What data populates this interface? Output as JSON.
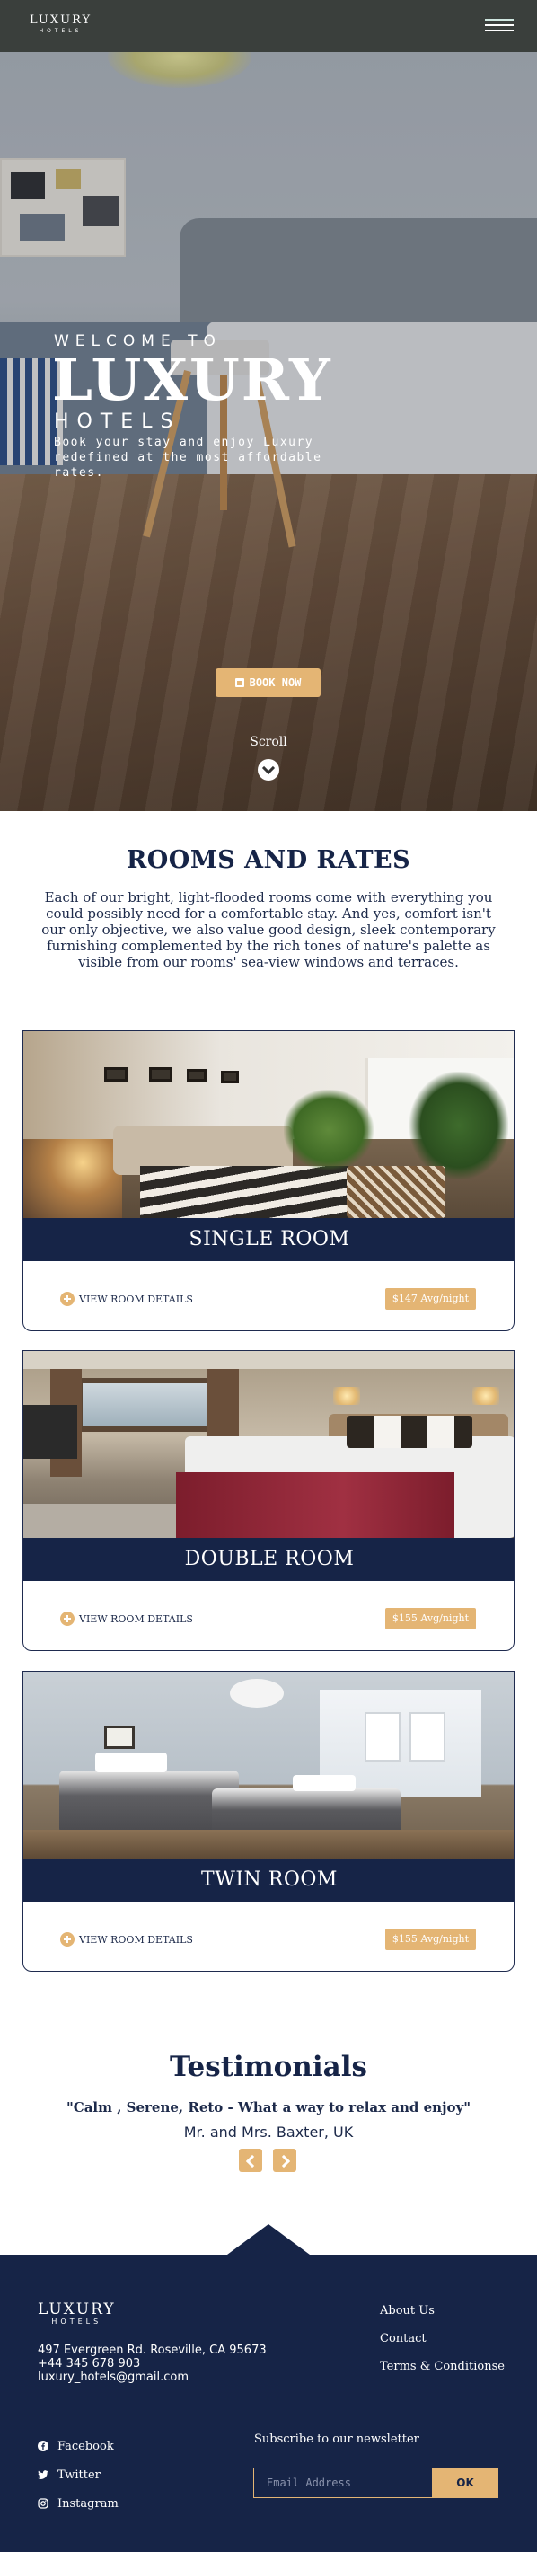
{
  "nav": {
    "logo_main": "LUXURY",
    "logo_sub": "HOTELS",
    "menu_icon": "hamburger-menu-icon"
  },
  "hero": {
    "welcome": "WELCOME TO",
    "title": "LUXURY",
    "subtitle": "HOTELS",
    "tagline": "Book your stay and enjoy Luxury redefined at the most affordable rates.",
    "book_button": "BOOK NOW",
    "book_icon": "calendar-icon",
    "scroll_label": "Scroll",
    "scroll_icon": "chevron-down-icon"
  },
  "rooms": {
    "title": "ROOMS AND RATES",
    "intro": "Each of our bright, light-flooded rooms come with everything you could possibly need for a comfortable stay. And yes, comfort isn't our only objective, we also value good design, sleek contemporary furnishing complemented by the rich tones of nature's palette as visible from our rooms' sea-view windows and terraces.",
    "items": [
      {
        "name": "SINGLE ROOM",
        "details": "VIEW ROOM DETAILS",
        "price": "$147 Avg/night"
      },
      {
        "name": "DOUBLE ROOM",
        "details": "VIEW ROOM DETAILS",
        "price": "$155 Avg/night"
      },
      {
        "name": "TWIN ROOM",
        "details": "VIEW ROOM DETAILS",
        "price": "$155 Avg/night"
      }
    ]
  },
  "testimonials": {
    "title": "Testimonials",
    "quote": "\"Calm , Serene, Reto - What a way to relax and enjoy\"",
    "author": "Mr. and Mrs. Baxter, UK"
  },
  "footer": {
    "logo_main": "LUXURY",
    "logo_sub": "HOTELS",
    "address": "497 Evergreen Rd. Roseville, CA 95673",
    "phone": "+44 345 678 903",
    "email": "luxury_hotels@gmail.com",
    "links": [
      "About Us",
      "Contact",
      "Terms & Conditionse"
    ],
    "social": [
      {
        "label": "Facebook",
        "icon": "facebook-icon"
      },
      {
        "label": "Twitter",
        "icon": "twitter-icon"
      },
      {
        "label": "Instagram",
        "icon": "instagram-icon"
      }
    ],
    "newsletter_label": "Subscribe to our newsletter",
    "newsletter_placeholder": "Email Address",
    "newsletter_button": "OK"
  },
  "colors": {
    "navy": "#162447",
    "gold": "#e4b574",
    "nav_bg": "#3a3f3c"
  }
}
